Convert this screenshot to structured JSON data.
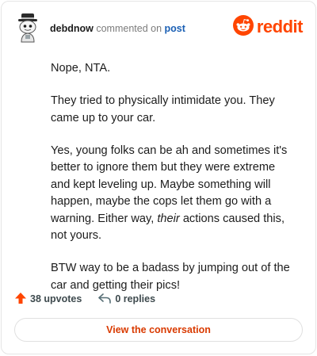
{
  "header": {
    "username": "debdnow",
    "action_text": "commented on",
    "target_link": "post",
    "brand": "reddit"
  },
  "comment": {
    "paragraphs": [
      {
        "text": "Nope, NTA."
      },
      {
        "text": "They tried to physically intimidate you. They came up to your car."
      },
      {
        "text": "Yes, young folks can be ah and sometimes it's better to ignore them but they were extreme and kept leveling up. Maybe something will happen, maybe the cops let them go with a warning. Either way, ",
        "emph": "their",
        "after": " actions caused this, not yours."
      },
      {
        "text": "BTW way to be a badass by jumping out of the car and getting their pics!"
      }
    ]
  },
  "stats": {
    "upvotes": "38 upvotes",
    "replies": "0 replies"
  },
  "cta": {
    "label": "View the conversation"
  },
  "colors": {
    "brand": "#ff4500",
    "link": "#1a5fb4",
    "cta_text": "#d93a00"
  },
  "icons": {
    "avatar": "user-avatar-icon",
    "brand": "reddit-logo-icon",
    "upvote": "upvote-arrow-icon",
    "reply": "reply-arrow-icon"
  }
}
